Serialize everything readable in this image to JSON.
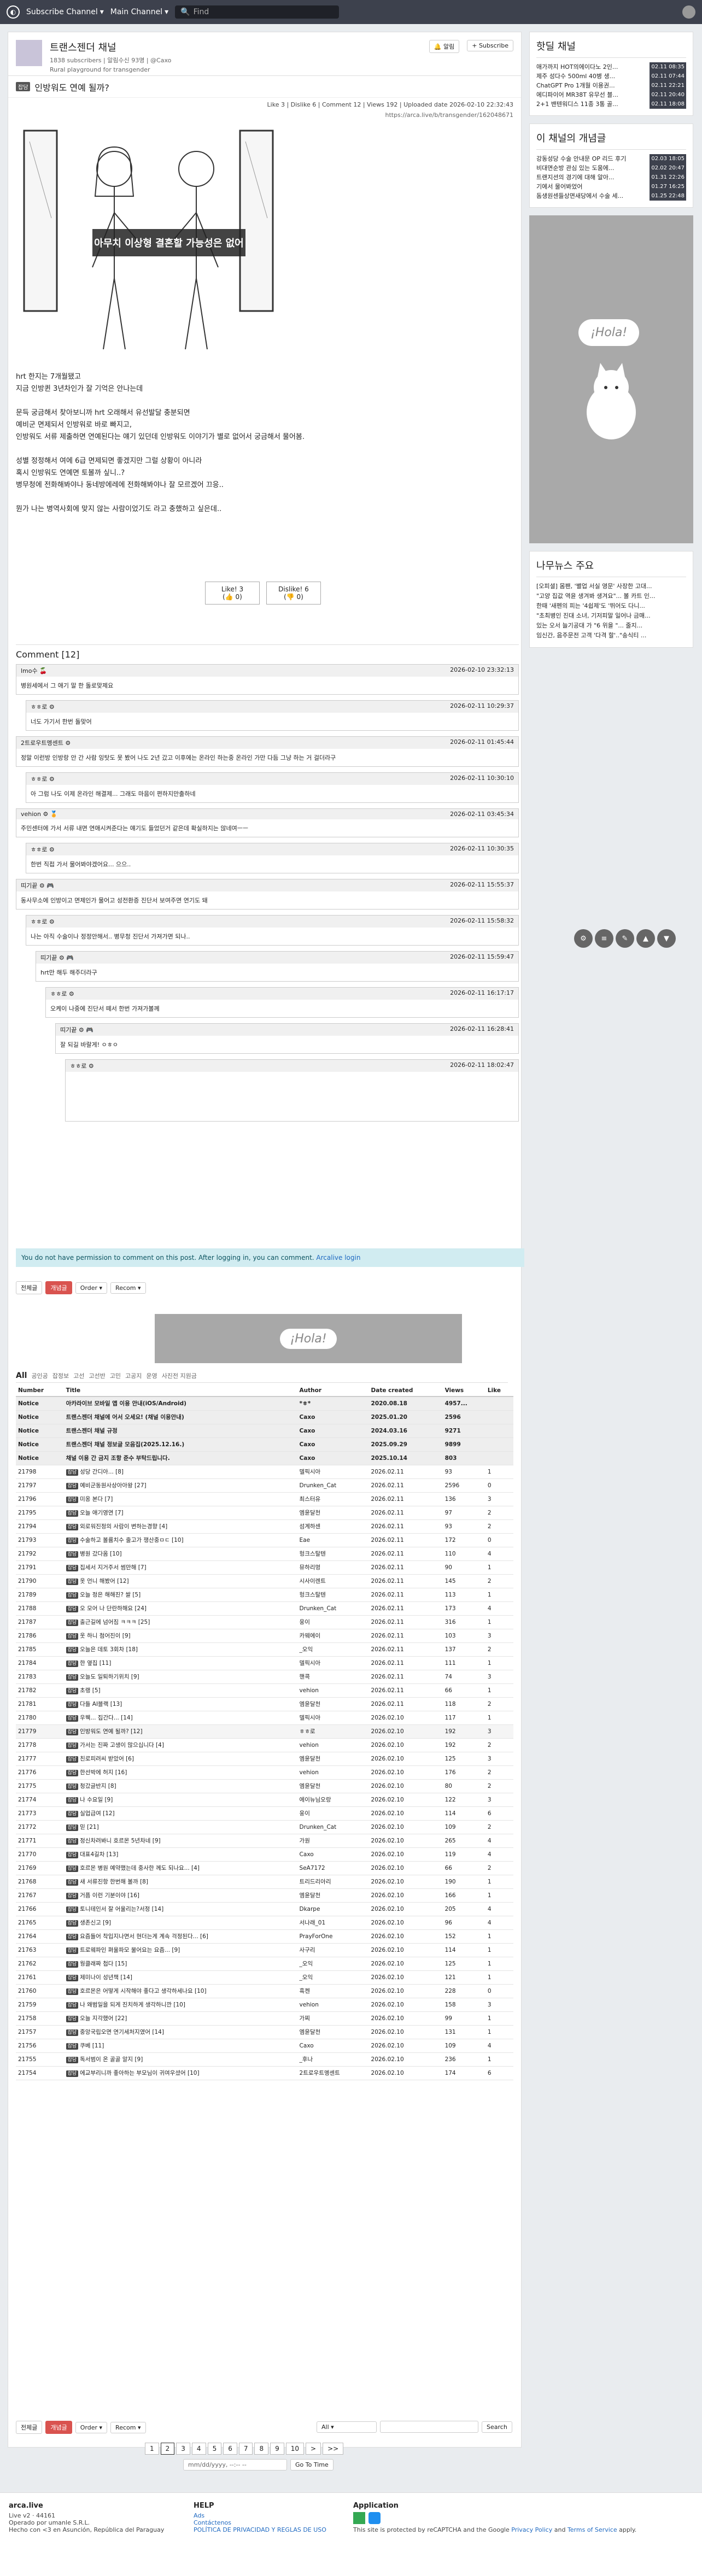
{
  "nav": {
    "subscribe": "Subscribe Channel",
    "main": "Main Channel",
    "find": "Find"
  },
  "channel": {
    "name": "트랜스젠더 채널",
    "subs": "1838 subscribers | 알림수신 93명 | @Caxo",
    "desc": "Rural playground for transgender",
    "alarm": "알림",
    "subscribe": "+ Subscribe"
  },
  "post": {
    "category": "잡담",
    "title": "인방워도 연예 될까?",
    "meta": "Like 3 | Dislike 6 | Comment 12 | Views 192 | Uploaded date 2026-02-10 22:32:43",
    "link": "https://arca.live/b/transgender/162048671",
    "img_text": "아무치 이상형 결혼할 가능성은 없어",
    "body": [
      "hrt 한지는 7개월됐고",
      "지금 인방퀸 3년차인가 잘 기억은 안나는데",
      "",
      "문득 궁금해서 찾아보니까 hrt 오래해서 유선발달 충분되면",
      "예비군 면제되서 인방워로 바로 빠지고,",
      "인방워도 서류 제출하면 연예된다는 얘기 있던데 인방워도 이야기가 별로 없어서 궁금해서 물어봄.",
      "",
      "성별 정정해서 여에 6급 면제되면 좋겠지만 그럴 상황이 아니라",
      "혹시 인방워도 연예면 토볼까 싶니..?",
      "병무청에 전화해봐야나 동네방에레에 전화해봐야나 잘 모르겠어 끄응..",
      "",
      "뭔가 나는 병역사회에 맞지 않는 사람이었기도 라고 충했하고 싶은데.."
    ],
    "like": "Like! 3",
    "like_sub": "(👍 0)",
    "dislike": "Dislike! 6",
    "dislike_sub": "(👎 0)"
  },
  "comments_title": "Comment [12]",
  "comments": [
    {
      "user": "lmo수 🍒",
      "date": "2026-02-10 23:32:13",
      "text": "병원세에서 그 애기 말 한 돌로맞제요",
      "indent": 0
    },
    {
      "user": "ㅎㅎ로 ⚙",
      "date": "2026-02-11 10:29:37",
      "text": "너도 가기서 한번 돌맞어",
      "indent": 1
    },
    {
      "user": "2트로우트멩센트 ⚙",
      "date": "2026-02-11 01:45:44",
      "text": "정말 이런방 인방랑 안 간 사람 잉탓도 못 봤어 나도 2년 갔고 이후에는 온라인 하는중 온라인 가만 다듬 그냥 하는 거 걸더라구",
      "indent": 0
    },
    {
      "user": "ㅎㅎ로 ⚙",
      "date": "2026-02-11 10:30:10",
      "text": "아 그럼 나도 이제 온라인 해결제... 그래도 마음이 편하지만출하네",
      "indent": 1
    },
    {
      "user": "vehion ⚙ 🏅",
      "date": "2026-02-11 03:45:34",
      "text": "주민센터에 가서 서류 내면 연애시켜준다는 얘기도 들었던거 같은데 확실하지는 않네여ㅡㅡ",
      "indent": 0
    },
    {
      "user": "ㅎㅎ로 ⚙",
      "date": "2026-02-11 10:30:35",
      "text": "한번 직접 가서 물어봐야겠어요... 으으..",
      "indent": 1
    },
    {
      "user": "띠기끝 ⚙ 🎮",
      "date": "2026-02-11 15:55:37",
      "text": "동사무소에 인방이고 면제인가 물어고 성전환증 진단서 보여주면 연기도 돼",
      "indent": 0
    },
    {
      "user": "ㅎㅎ로 ⚙",
      "date": "2026-02-11 15:58:32",
      "text": "나는 아직 수술이나 정정안해서.. 병무청 진단서 가져가면 되나..",
      "indent": 1
    },
    {
      "user": "띠기끝 ⚙ 🎮",
      "date": "2026-02-11 15:59:47",
      "text": "hrt만 해두 해주더라구",
      "indent": 2
    },
    {
      "user": "ㅎㅎ로 ⚙",
      "date": "2026-02-11 16:17:17",
      "text": "오케이 나중에 진단서 떼서 한번 가져가볼께",
      "indent": 3
    },
    {
      "user": "띠기끝 ⚙ 🎮",
      "date": "2026-02-11 16:28:41",
      "text": "잘 되길 바랄게! ㅇㅎㅇ",
      "indent": 4
    },
    {
      "user": "ㅎㅎ로 ⚙",
      "date": "2026-02-11 18:02:47",
      "text": "",
      "indent": 5
    }
  ],
  "no_permission": "You do not have permission to comment on this post. After logging in, you can comment.",
  "login_link": "Arcalive login",
  "toolbar": {
    "all": "전체글",
    "best": "개념글",
    "order": "Order",
    "recom": "Recom"
  },
  "banner": "¡Hola!",
  "tabs": [
    "All",
    "공인공",
    "잡정보",
    "고선",
    "고선반",
    "고민",
    "고공지",
    "운영",
    "사진전 지원금"
  ],
  "table_head": [
    "Number",
    "Title",
    "Author",
    "Date created",
    "Views",
    "Like"
  ],
  "notices": [
    {
      "t": "아카라이브 모바일 앱 이용 안내(iOS/Android)",
      "a": "*ㅎ*",
      "d": "2020.08.18",
      "v": "4957...",
      "l": ""
    },
    {
      "t": "트랜스젠더 채널에 어서 오세요! (채널 이용안내)",
      "a": "Caxo",
      "d": "2025.01.20",
      "v": "2596",
      "l": ""
    },
    {
      "t": "트랜스젠더 채널 규정",
      "a": "Caxo",
      "d": "2024.03.16",
      "v": "9271",
      "l": ""
    },
    {
      "t": "트랜스젠더 채널 정보글 모음집(2025.12.16.)",
      "a": "Caxo",
      "d": "2025.09.29",
      "v": "9899",
      "l": ""
    },
    {
      "t": "채널 이용 간 금지 조항 준수 부탁드립니다.",
      "a": "Caxo",
      "d": "2025.10.14",
      "v": "803",
      "l": ""
    }
  ],
  "rows": [
    [
      "21798",
      "잡담",
      "성당 간디아... [8]",
      "델픽시아",
      "2026.02.11",
      "93",
      "1"
    ],
    [
      "21797",
      "잡담",
      "예비군동원사상아아왕 [27]",
      "Drunken_Cat",
      "2026.02.11",
      "2596",
      "0"
    ],
    [
      "21796",
      "잡담",
      "미옹 본다 [7]",
      "최스터유",
      "2026.02.11",
      "136",
      "3"
    ],
    [
      "21795",
      "잡담",
      "오늘 애기영연 [7]",
      "엠윤달천",
      "2026.02.11",
      "97",
      "2"
    ],
    [
      "21794",
      "잡담",
      "외로워진정의 사람이 변하는경향 [4]",
      "섬계하센",
      "2026.02.11",
      "93",
      "2"
    ],
    [
      "21793",
      "잡담",
      "수술하고 볼륨치수 줄고가 쟁산중ㅁㄷ [10]",
      "Eae",
      "2026.02.11",
      "172",
      "0"
    ],
    [
      "21792",
      "잡담",
      "병원 갔다옴 [10]",
      "헝크스탈텐",
      "2026.02.11",
      "110",
      "4"
    ],
    [
      "21791",
      "잡담",
      "집세서 지거주서 썸만해 [7]",
      "뮤하리멍",
      "2026.02.11",
      "90",
      "1"
    ],
    [
      "21790",
      "잡담",
      "옷 언니 해봤어 [12]",
      "시사이렌트",
      "2026.02.11",
      "145",
      "2"
    ],
    [
      "21789",
      "잡담",
      "오늘 정은 해해진? 쌀 [5]",
      "헝크스탈텐",
      "2026.02.11",
      "113",
      "1"
    ],
    [
      "21788",
      "잡담",
      "오 모어 나 단란하해요 [24]",
      "Drunken_Cat",
      "2026.02.11",
      "173",
      "4"
    ],
    [
      "21787",
      "잡담",
      "출근길에 넘어짐 ㅋㅋㅋ [25]",
      "웅이",
      "2026.02.11",
      "316",
      "1"
    ],
    [
      "21786",
      "잡담",
      "옷 하니 첨어진이 [9]",
      "카웨에이",
      "2026.02.11",
      "103",
      "3"
    ],
    [
      "21785",
      "잡담",
      "오늘은 데토 3회차 [18]",
      "_오익",
      "2026.02.11",
      "137",
      "2"
    ],
    [
      "21784",
      "잡담",
      "한 옆집 [11]",
      "델픽시아",
      "2026.02.11",
      "111",
      "1"
    ],
    [
      "21783",
      "잡담",
      "오늘도 일퇴하기위치 [9]",
      "핸콕",
      "2026.02.11",
      "74",
      "3"
    ],
    [
      "21782",
      "잡담",
      "초랭 [5]",
      "vehion",
      "2026.02.11",
      "66",
      "1"
    ],
    [
      "21781",
      "잡담",
      "다들 AI블랙 [13]",
      "엠윤달천",
      "2026.02.11",
      "118",
      "2"
    ],
    [
      "21780",
      "잡담",
      "우웩... 집간다... [14]",
      "델픽시아",
      "2026.02.10",
      "117",
      "1"
    ],
    [
      "21779",
      "잡담",
      "인방워도 연예 될까? [12]",
      "ㅎㅎ로",
      "2026.02.10",
      "192",
      "3"
    ],
    [
      "21778",
      "잡담",
      "가서는 진짜 고생이 많으십니다 [4]",
      "vehion",
      "2026.02.10",
      "192",
      "2"
    ],
    [
      "21777",
      "잡담",
      "친로피려씨 받았어 [6]",
      "엠윤달천",
      "2026.02.10",
      "125",
      "3"
    ],
    [
      "21776",
      "잡담",
      "한선박에 허지 [16]",
      "vehion",
      "2026.02.10",
      "176",
      "2"
    ],
    [
      "21775",
      "잡담",
      "청갔글반지 [8]",
      "엠윤달천",
      "2026.02.10",
      "80",
      "2"
    ],
    [
      "21774",
      "잡담",
      "나 수요일 [9]",
      "에이뉴님오랑",
      "2026.02.10",
      "122",
      "3"
    ],
    [
      "21773",
      "잡담",
      "실업급여 [12]",
      "웅이",
      "2026.02.10",
      "114",
      "6"
    ],
    [
      "21772",
      "잡담",
      "믿 [21]",
      "Drunken_Cat",
      "2026.02.10",
      "109",
      "2"
    ],
    [
      "21771",
      "잡담",
      "정신차려봐니 호르몬 5년차네 [9]",
      "가원",
      "2026.02.10",
      "265",
      "4"
    ],
    [
      "21770",
      "잡담",
      "대표4길차 [13]",
      "Caxo",
      "2026.02.10",
      "119",
      "4"
    ],
    [
      "21769",
      "잡담",
      "호르몬 병원 예약했는데 중사한 께도 되나요... [4]",
      "SeA7172",
      "2026.02.10",
      "66",
      "2"
    ],
    [
      "21768",
      "잡담",
      "새 서류진항 한번해 볼까 [8]",
      "트리드리아리",
      "2026.02.10",
      "190",
      "1"
    ],
    [
      "21767",
      "잡담",
      "거픔 이런 기분이야 [16]",
      "엠윤달천",
      "2026.02.10",
      "166",
      "1"
    ],
    [
      "21766",
      "잡담",
      "토니테인서 잘 어울리는?서정 [14]",
      "Dkarpe",
      "2026.02.10",
      "205",
      "4"
    ],
    [
      "21765",
      "잡담",
      "생존신고 [9]",
      "서나래_01",
      "2026.02.10",
      "96",
      "4"
    ],
    [
      "21764",
      "잡담",
      "요즘들어 착입지나면서 현더는게 계속 걱정된다... [6]",
      "PrayForOne",
      "2026.02.10",
      "152",
      "1"
    ],
    [
      "21763",
      "잡담",
      "트로웨파인 펴울파모 물어요는 요즘... [9]",
      "사구리",
      "2026.02.10",
      "114",
      "1"
    ],
    [
      "21762",
      "잡담",
      "웡클래짜 첩다 [15]",
      "_오익",
      "2026.02.10",
      "125",
      "1"
    ],
    [
      "21761",
      "잡담",
      "제미나이 성년책 [14]",
      "_오익",
      "2026.02.10",
      "121",
      "1"
    ],
    [
      "21760",
      "잡담",
      "호르몬은 어떻게 시작해야 좋다고 생각하세나요 [10]",
      "흑켄",
      "2026.02.10",
      "228",
      "0"
    ],
    [
      "21759",
      "잡담",
      "나 왜범일을 되게 진치하게 생각하니깐 [10]",
      "vehion",
      "2026.02.10",
      "158",
      "3"
    ],
    [
      "21758",
      "잡담",
      "오늘 지각했어 [22]",
      "가찌",
      "2026.02.10",
      "99",
      "1"
    ],
    [
      "21757",
      "잡담",
      "중앙국립오면 연기세처지였어 [14]",
      "엠윤달천",
      "2026.02.10",
      "131",
      "1"
    ],
    [
      "21756",
      "잡담",
      "쿠베 [11]",
      "Caxo",
      "2026.02.10",
      "109",
      "4"
    ],
    [
      "21755",
      "잡담",
      "독서범이 온 골골 알지 [9]",
      "_후나",
      "2026.02.10",
      "236",
      "1"
    ],
    [
      "21754",
      "잡담",
      "에교부리니까 좋아하는 부모님이 귀여우셨어 [10]",
      "2트로우트멩센트",
      "2026.02.10",
      "174",
      "6"
    ]
  ],
  "search": {
    "select": "All",
    "button": "Search",
    "date_placeholder": "mm/dd/yyyy, --:-- --",
    "goto": "Go To Time"
  },
  "pages": [
    "1",
    "2",
    "3",
    "4",
    "5",
    "6",
    "7",
    "8",
    "9",
    "10",
    ">",
    ">>"
  ],
  "sidebar": {
    "hot_title": "핫딜 채널",
    "hot": [
      [
        "애가까지 HOT의에이다노 2인...",
        "02.11 08:35"
      ],
      [
        "제주 성다수 500ml 40병 생...",
        "02.11 07:44"
      ],
      [
        "ChatGPT Pro 1개월 이용권...",
        "02.11 22:21"
      ],
      [
        "에디파이어 MR38T 유무선 블...",
        "02.11 20:40"
      ],
      [
        "2+1 밴텐워디스 11종 3통 골...",
        "02.11 18:08"
      ]
    ],
    "best_title": "이 채널의 개념글",
    "best": [
      [
        "강동성당 수술 안내문 OP 리드 후기",
        "02.03 18:05"
      ],
      [
        "비대면순방 관심 있는 도움에...",
        "02.02 20:47"
      ],
      [
        "트랜지션의 경기에 대해 알아...",
        "01.31 22:26"
      ],
      [
        "기에서 물어봐었어",
        "01.27 16:25"
      ],
      [
        "돔생원센들상면새당에서 수술 세...",
        "01.25 22:48"
      ]
    ],
    "news_title": "나무뉴스 주요",
    "news": [
      "[오피셜] 몸팬, '별업 서실 영문' 사장한 고대...",
      "\"고양 집값 역윤 생겨봐 생겨요\"... 볼 카트 인...",
      "한때 '새펜의 피는 '4쉽제'도 '뛰어도 다니...",
      "\"초최병인 진대 소녀, 기저피말 일어나 금매...",
      "있는 오서 늘기공대 가 \"6 위을 \"... 줄지...",
      "임신간, 음주문전 고객 '다격 할'..\"송식티 ..."
    ],
    "hola": "¡Hola!"
  },
  "footer": {
    "brand": "arca.live",
    "version": "Live v2",
    "stats": "44161",
    "operated": "Operado por umanle S.R.L.",
    "made": "Hecho con <3 en Asunción, República del Paraguay",
    "help": "HELP",
    "ads": "Ads",
    "contact": "Contáctenos",
    "policy": "POLÍTICA DE PRIVACIDAD Y REGLAS DE USO",
    "app": "Application",
    "captcha": "This site is protected by reCAPTCHA and the Google",
    "pp": "Privacy Policy",
    "and": "and",
    "tos": "Terms of Service",
    "apply": "apply."
  }
}
